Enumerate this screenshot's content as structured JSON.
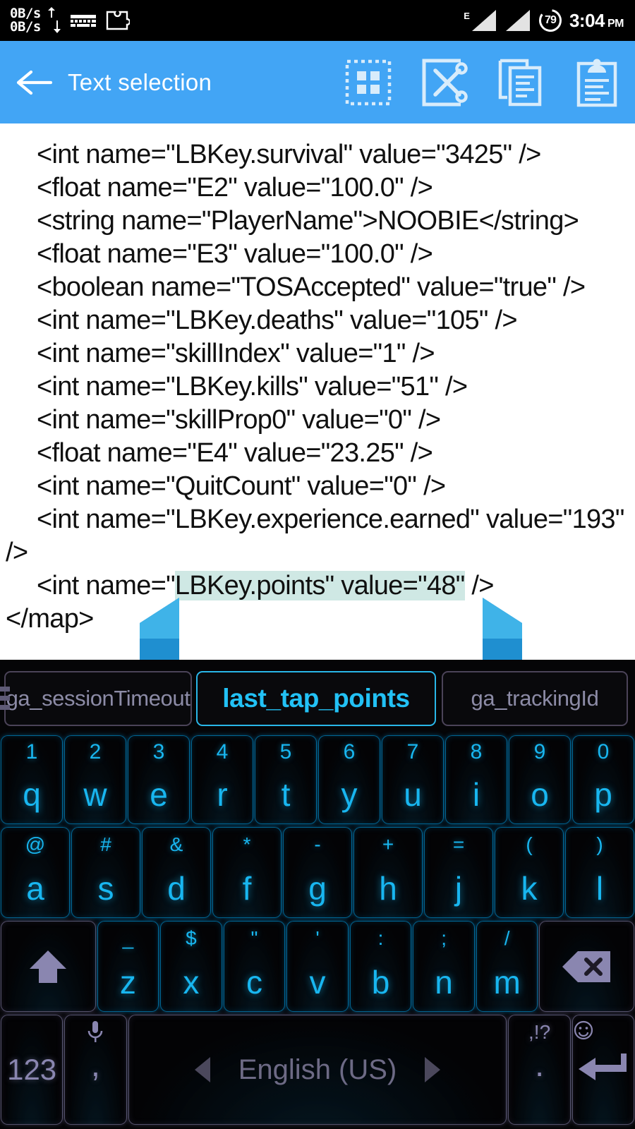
{
  "statusbar": {
    "net_up": "0B/s",
    "net_down": "0B/s",
    "icons": [
      "upload-download-icon",
      "keyboard-icon",
      "puzzle-piece-icon"
    ],
    "network_type": "E",
    "battery_percent": "79",
    "time": "3:04",
    "ampm": "PM"
  },
  "actionbar": {
    "title": "Text selection",
    "back_label": "back-arrow",
    "buttons": [
      {
        "name": "select-all",
        "label": "Select all"
      },
      {
        "name": "cut",
        "label": "Cut"
      },
      {
        "name": "copy",
        "label": "Copy"
      },
      {
        "name": "paste",
        "label": "Paste"
      }
    ]
  },
  "editor": {
    "lines": [
      "<int name=\"LBKey.survival\" value=\"3425\" />",
      "<float name=\"E2\" value=\"100.0\" />",
      "<string name=\"PlayerName\">NOOBIE</string>",
      "<float name=\"E3\" value=\"100.0\" />",
      "<boolean name=\"TOSAccepted\" value=\"true\" />",
      "<int name=\"LBKey.deaths\" value=\"105\" />",
      "<int name=\"skillIndex\" value=\"1\" />",
      "<int name=\"LBKey.kills\" value=\"51\" />",
      "<int name=\"skillProp0\" value=\"0\" />",
      "<float name=\"E4\" value=\"23.25\" />",
      "<int name=\"QuitCount\" value=\"0\" />",
      "<int name=\"LBKey.experience.earned\" value=\"193\" />"
    ],
    "selected_line_prefix": "<int name=\"",
    "selected_text": "LBKey.points\" value=\"48\"",
    "selected_line_suffix": " />",
    "closing_tag": "</map>",
    "selection_color": "#cfe8e4",
    "handle_color": "#2196d6"
  },
  "keyboard": {
    "suggestions": [
      {
        "text": "ga_sessionTimeout",
        "active": false
      },
      {
        "text": "last_tap_points",
        "active": true
      },
      {
        "text": "ga_trackingId",
        "active": false
      }
    ],
    "row1": [
      {
        "alt": "1",
        "main": "q"
      },
      {
        "alt": "2",
        "main": "w"
      },
      {
        "alt": "3",
        "main": "e"
      },
      {
        "alt": "4",
        "main": "r"
      },
      {
        "alt": "5",
        "main": "t"
      },
      {
        "alt": "6",
        "main": "y"
      },
      {
        "alt": "7",
        "main": "u"
      },
      {
        "alt": "8",
        "main": "i"
      },
      {
        "alt": "9",
        "main": "o"
      },
      {
        "alt": "0",
        "main": "p"
      }
    ],
    "row2": [
      {
        "alt": "@",
        "main": "a"
      },
      {
        "alt": "#",
        "main": "s"
      },
      {
        "alt": "&",
        "main": "d"
      },
      {
        "alt": "*",
        "main": "f"
      },
      {
        "alt": "-",
        "main": "g"
      },
      {
        "alt": "+",
        "main": "h"
      },
      {
        "alt": "=",
        "main": "j"
      },
      {
        "alt": "(",
        "main": "k"
      },
      {
        "alt": ")",
        "main": "l"
      }
    ],
    "row3": [
      {
        "alt": "_",
        "main": "z"
      },
      {
        "alt": "$",
        "main": "x"
      },
      {
        "alt": "\"",
        "main": "c"
      },
      {
        "alt": "'",
        "main": "v"
      },
      {
        "alt": ":",
        "main": "b"
      },
      {
        "alt": ";",
        "main": "n"
      },
      {
        "alt": "/",
        "main": "m"
      }
    ],
    "shift_label": "shift-arrow-icon",
    "backspace_label": "backspace-icon",
    "row4": {
      "numeric_label": "123",
      "comma_label": ",",
      "comma_alt": "mic-icon",
      "space_label": "English (US)",
      "period_label": ".",
      "period_alt": ",!?",
      "enter_label": "enter-icon",
      "enter_alt": "emoji-icon"
    }
  }
}
